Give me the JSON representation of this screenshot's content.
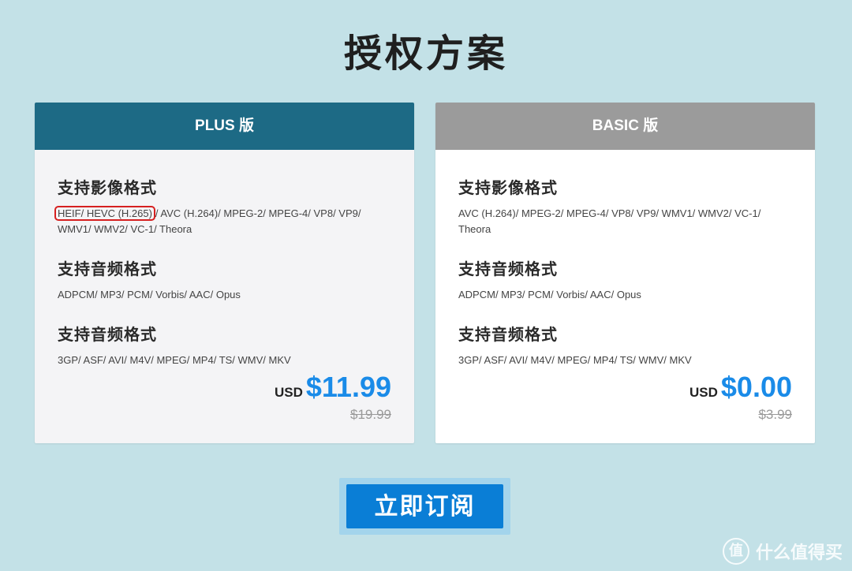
{
  "page": {
    "title": "授权方案"
  },
  "plans": [
    {
      "name": "PLUS 版",
      "sections": [
        {
          "title": "支持影像格式",
          "highlight": "HEIF/ HEVC (H.265)",
          "text": "/ AVC (H.264)/ MPEG-2/ MPEG-4/ VP8/ VP9/ WMV1/ WMV2/ VC-1/ Theora"
        },
        {
          "title": "支持音频格式",
          "text": "ADPCM/ MP3/ PCM/ Vorbis/ AAC/ Opus"
        },
        {
          "title": "支持音频格式",
          "text": "3GP/ ASF/ AVI/ M4V/ MPEG/ MP4/ TS/ WMV/ MKV"
        }
      ],
      "currency": "USD",
      "price": "$11.99",
      "old_price": "$19.99"
    },
    {
      "name": "BASIC 版",
      "sections": [
        {
          "title": "支持影像格式",
          "text": "AVC (H.264)/ MPEG-2/ MPEG-4/ VP8/ VP9/ WMV1/ WMV2/ VC-1/ Theora"
        },
        {
          "title": "支持音频格式",
          "text": "ADPCM/ MP3/ PCM/ Vorbis/ AAC/ Opus"
        },
        {
          "title": "支持音频格式",
          "text": "3GP/ ASF/ AVI/ M4V/ MPEG/ MP4/ TS/ WMV/ MKV"
        }
      ],
      "currency": "USD",
      "price": "$0.00",
      "old_price": "$3.99"
    }
  ],
  "subscribe_label": "立即订阅",
  "watermark": {
    "logo_char": "值",
    "text": "什么值得买"
  },
  "colors": {
    "background": "#c3e1e7",
    "plus_header": "#1d6a85",
    "basic_header": "#9b9b9b",
    "price": "#1a8be8",
    "button": "#0a7ed6",
    "highlight_border": "#d62020"
  }
}
